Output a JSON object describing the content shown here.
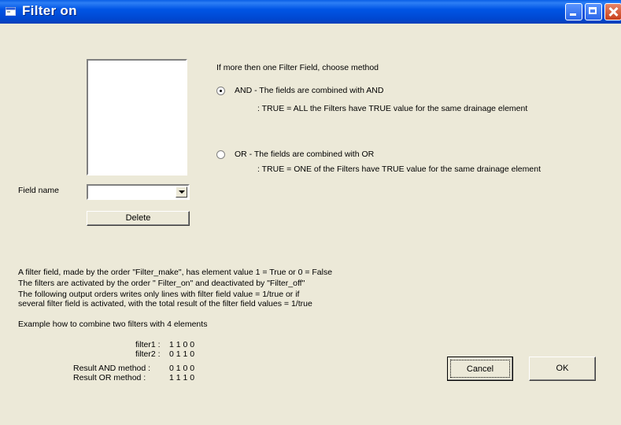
{
  "window": {
    "title": "Filter on",
    "icon": "app-window-icon"
  },
  "left_panel": {
    "field_name_label": "Field name",
    "field_name_value": "",
    "delete_label": "Delete"
  },
  "method": {
    "heading": "If more then one Filter Field, choose method",
    "and": {
      "label": "AND  -  The fields are combined with  AND",
      "desc": ":  TRUE = ALL the  Filters have TRUE value for the same drainage element",
      "checked": true
    },
    "or": {
      "label": "OR  -  The fields are combined with  OR",
      "desc": ":  TRUE = ONE of the Filters have TRUE value for the same drainage element",
      "checked": false
    }
  },
  "info": {
    "lines": [
      "A filter field, made by the order \"Filter_make\",  has element value 1 = True or 0 = False",
      "The filters are activated by the order \" Filter_on\" and  deactivated by \"Filter_off\"",
      "The following output orders writes only  lines with filter field value = 1/true  or  if",
      "several filter field is activated, with the total result of the filter field values  = 1/true"
    ],
    "example_heading": "Example how to combine two filters with 4 elements",
    "example": [
      {
        "label": "filter1 :",
        "values": "1   1   0   0"
      },
      {
        "label": "filter2 :",
        "values": "0   1   1   0"
      },
      {
        "label": "Result AND method :",
        "values": "0   1   0   0"
      },
      {
        "label": "Result OR method   :",
        "values": "1   1   1   0"
      }
    ]
  },
  "buttons": {
    "cancel": "Cancel",
    "ok": "OK"
  }
}
